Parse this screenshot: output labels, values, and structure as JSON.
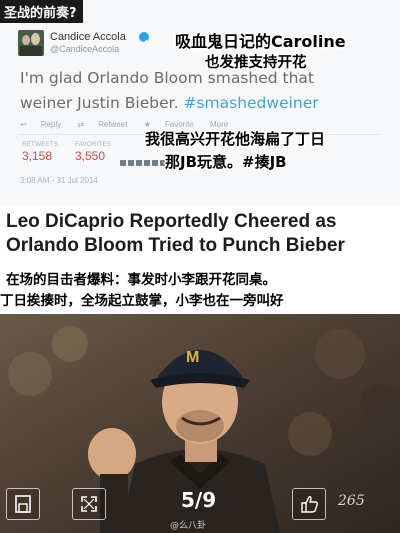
{
  "captions": {
    "title_tag": "圣战的前奏?",
    "caroline_line1": "吸血鬼日记的Caroline",
    "caroline_line2": "也发推支持开花",
    "comment_line1": "我很高兴开花他海扁了丁日",
    "comment_line2": "那JB玩意。#揍JB",
    "witness_line1": "在场的目击者爆料：事发时小李跟开花同桌。",
    "witness_line2": "丁日挨揍时，全场起立鼓掌，小李也在一旁叫好"
  },
  "tweet": {
    "name": "Candice Accola",
    "handle": "@CandiceAccola",
    "text_main": "I'm glad Orlando Bloom smashed that weiner Justin Bieber.",
    "hashtag": "#smashedweiner",
    "action_reply": "Reply",
    "action_retweet": "Retweet",
    "action_favorite": "Favorite",
    "action_more": "More",
    "retweets_label": "RETWEETS",
    "retweets_value": "3,158",
    "favorites_label": "FAVORITES",
    "favorites_value": "3,550",
    "timestamp": "3:08 AM - 31 Jul 2014"
  },
  "headline": "Leo DiCaprio Reportedly Cheered as Orlando Bloom Tried to Punch Bieber",
  "gallery": {
    "counter": "5/9",
    "likes": "265",
    "watermark": "@么八卦"
  },
  "icons": [
    "verified-icon",
    "reply-icon",
    "retweet-icon",
    "favorite-icon",
    "save-icon",
    "fullscreen-icon",
    "thumbs-up-icon"
  ]
}
